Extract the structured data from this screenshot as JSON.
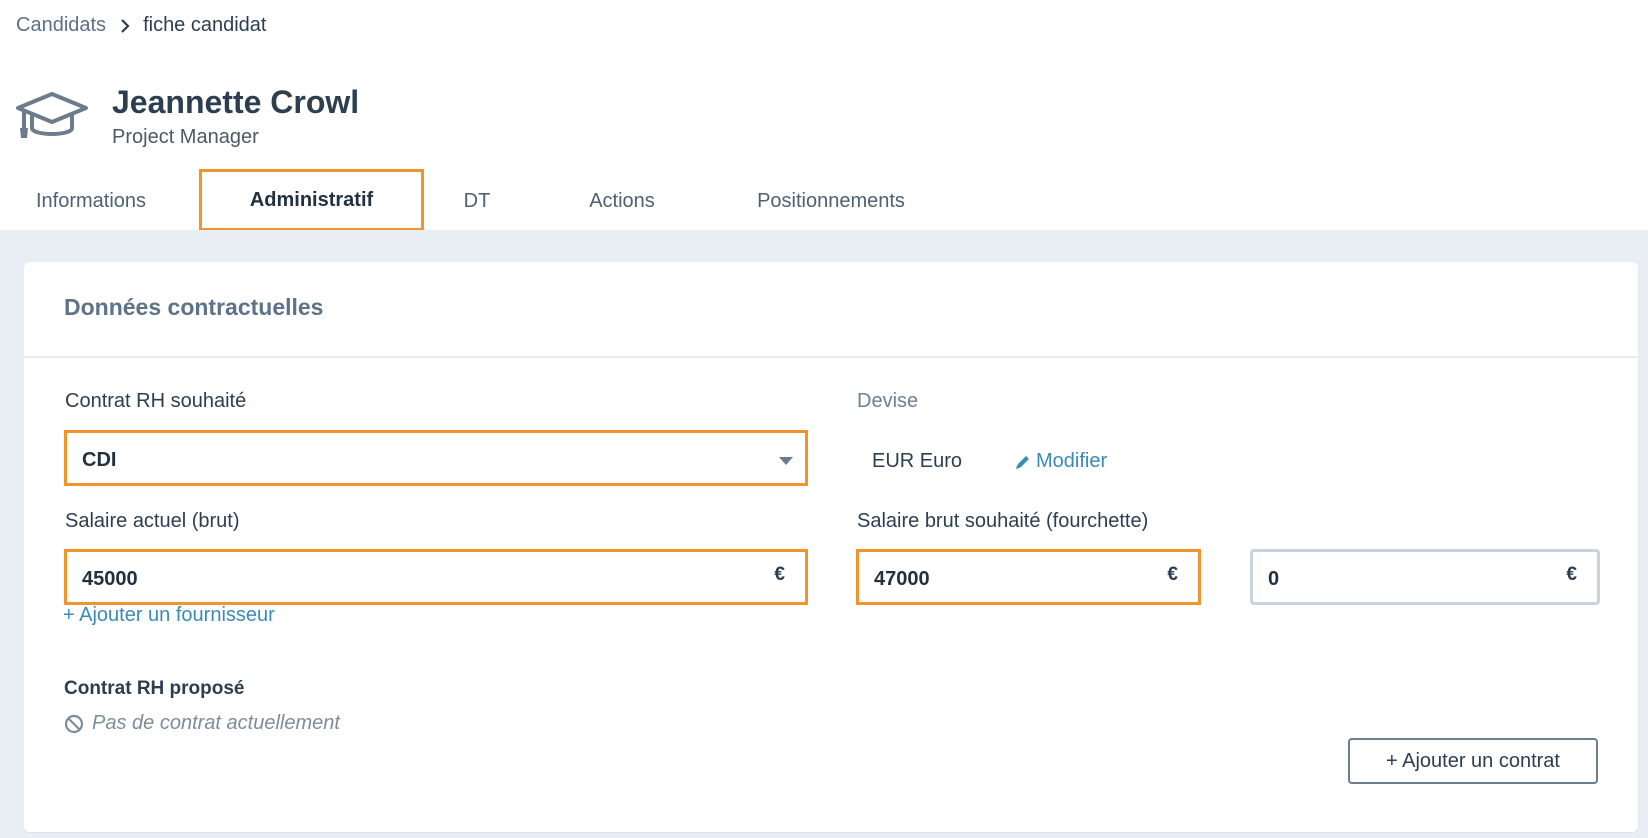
{
  "breadcrumb": {
    "parent": "Candidats",
    "current": "fiche candidat"
  },
  "candidate": {
    "name": "Jeannette Crowl",
    "role": "Project Manager"
  },
  "tabs": [
    {
      "label": "Informations"
    },
    {
      "label": "Administratif"
    },
    {
      "label": "DT"
    },
    {
      "label": "Actions"
    },
    {
      "label": "Positionnements"
    }
  ],
  "active_tab": "Administratif",
  "section": {
    "title": "Données contractuelles",
    "contrat_rh": {
      "label": "Contrat RH souhaité",
      "value": "CDI"
    },
    "devise": {
      "label": "Devise",
      "value": "EUR Euro",
      "modify_label": "Modifier"
    },
    "salaire_actuel": {
      "label": "Salaire actuel (brut)",
      "value": "45000",
      "currency": "€"
    },
    "salaire_souhaite": {
      "label": "Salaire brut souhaité (fourchette)",
      "min": "47000",
      "max": "0",
      "currency": "€"
    },
    "add_supplier_label": "+ Ajouter un fournisseur",
    "contrat_propose": {
      "label": "Contrat RH proposé",
      "empty_text": "Pas de contrat actuellement",
      "add_button": "+ Ajouter un contrat"
    }
  },
  "colors": {
    "highlight": "#f0952b",
    "link": "#3a8bb5",
    "background": "#e9eef5"
  },
  "icons": [
    "chevron-right-icon",
    "graduation-cap-icon",
    "pencil-icon",
    "no-entry-icon",
    "caret-down-icon"
  ]
}
